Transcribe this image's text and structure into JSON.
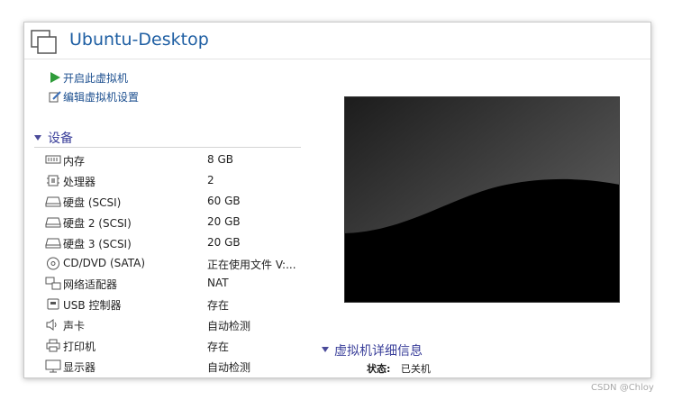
{
  "window": {
    "title": "Ubuntu-Desktop"
  },
  "actions": [
    {
      "label": "开启此虚拟机",
      "icon": "play-icon"
    },
    {
      "label": "编辑虚拟机设置",
      "icon": "edit-settings-icon"
    }
  ],
  "devices": {
    "title": "设备",
    "items": [
      {
        "name": "内存",
        "value": "8 GB",
        "icon": "memory-icon"
      },
      {
        "name": "处理器",
        "value": "2",
        "icon": "cpu-icon"
      },
      {
        "name": "硬盘 (SCSI)",
        "value": "60 GB",
        "icon": "harddisk-icon"
      },
      {
        "name": "硬盘 2 (SCSI)",
        "value": "20 GB",
        "icon": "harddisk-icon"
      },
      {
        "name": "硬盘 3 (SCSI)",
        "value": "20 GB",
        "icon": "harddisk-icon"
      },
      {
        "name": "CD/DVD (SATA)",
        "value": "正在使用文件 V:...",
        "icon": "cd-dvd-icon"
      },
      {
        "name": "网络适配器",
        "value": "NAT",
        "icon": "network-icon"
      },
      {
        "name": "USB 控制器",
        "value": "存在",
        "icon": "usb-icon"
      },
      {
        "name": "声卡",
        "value": "自动检测",
        "icon": "speaker-icon"
      },
      {
        "name": "打印机",
        "value": "存在",
        "icon": "printer-icon"
      },
      {
        "name": "显示器",
        "value": "自动检测",
        "icon": "monitor-icon"
      }
    ]
  },
  "details": {
    "title": "虚拟机详细信息",
    "state_label": "状态:",
    "state_value": "已关机"
  },
  "watermark": "CSDN @Chloy"
}
